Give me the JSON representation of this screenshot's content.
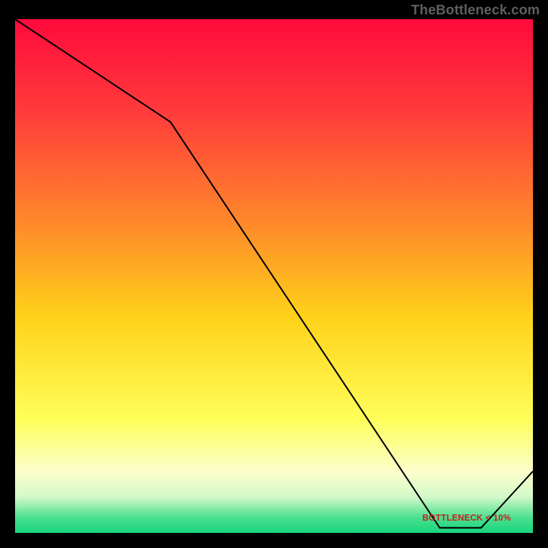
{
  "attribution": "TheBottleneck.com",
  "band_label": "BOTTLENECK < 10%",
  "chart_data": {
    "type": "line",
    "title": "",
    "xlabel": "",
    "ylabel": "",
    "xlim": [
      0,
      100
    ],
    "ylim": [
      0,
      100
    ],
    "series": [
      {
        "name": "bottleneck-curve",
        "x": [
          0,
          30,
          82,
          90,
          100
        ],
        "y": [
          100,
          80,
          1,
          1,
          12
        ]
      }
    ],
    "gradient_stops": [
      {
        "pos": 0.0,
        "color": "#ff0a3c"
      },
      {
        "pos": 0.18,
        "color": "#ff3b3b"
      },
      {
        "pos": 0.4,
        "color": "#ff8a2a"
      },
      {
        "pos": 0.58,
        "color": "#ffd21a"
      },
      {
        "pos": 0.78,
        "color": "#ffff5a"
      },
      {
        "pos": 0.88,
        "color": "#fbffcb"
      },
      {
        "pos": 0.93,
        "color": "#d3f9c9"
      },
      {
        "pos": 0.97,
        "color": "#4be08e"
      },
      {
        "pos": 1.0,
        "color": "#18d47e"
      }
    ],
    "optimal_band": {
      "x_start": 78,
      "x_end": 92
    }
  }
}
